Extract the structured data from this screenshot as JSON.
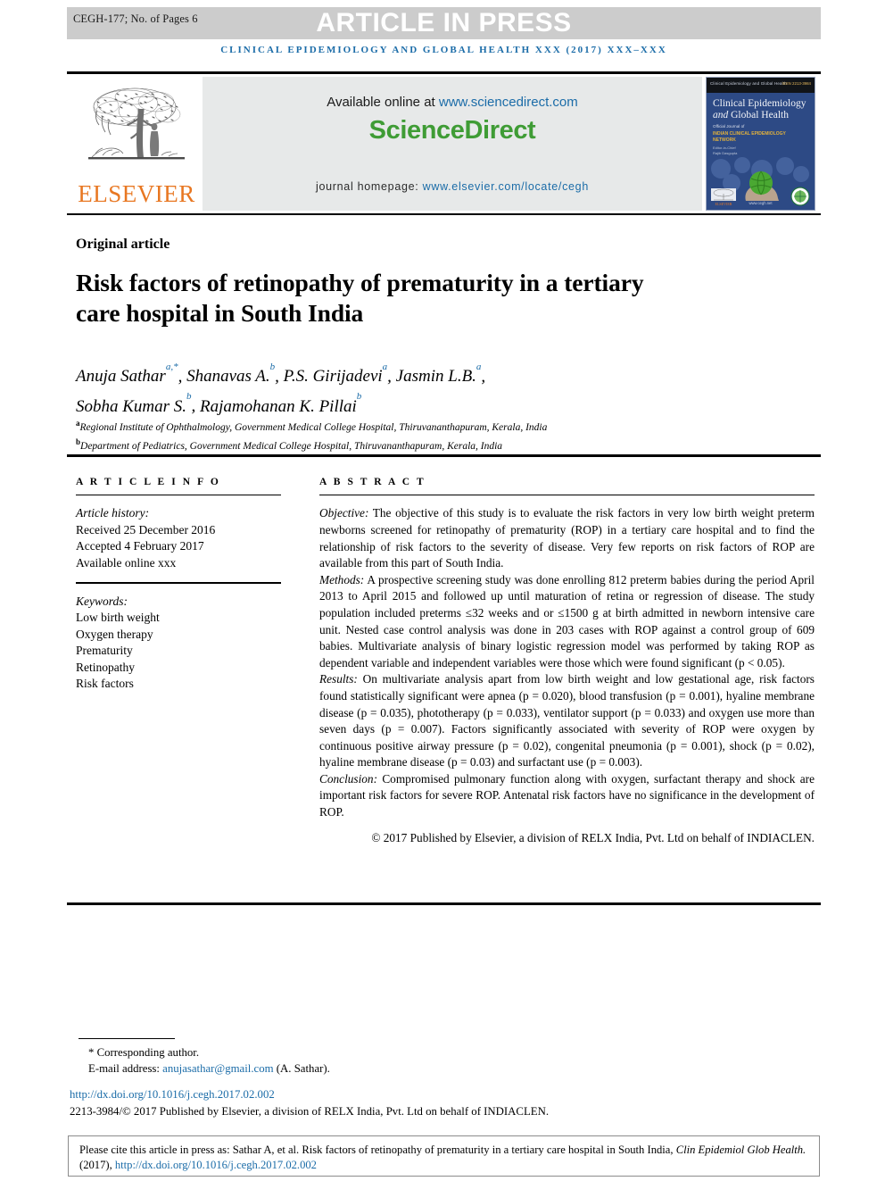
{
  "header": {
    "runhead": "CEGH-177; No. of Pages 6",
    "press_banner": "ARTICLE IN PRESS",
    "journal_running_title": "CLINICAL EPIDEMIOLOGY AND GLOBAL HEALTH XXX (2017) XXX–XXX"
  },
  "masthead": {
    "publisher_name": "ELSEVIER",
    "available_prefix": "Available online at ",
    "available_url": "www.sciencedirect.com",
    "sciencedirect_logo_a": "Science",
    "sciencedirect_logo_b": "Direct",
    "homepage_prefix": "journal homepage: ",
    "homepage_url": "www.elsevier.com/locate/cegh",
    "colors": {
      "elsevier_orange": "#E87722",
      "sciencedirect_green": "#3F9C35",
      "link_blue": "#1B6CA8",
      "banner_grey": "#CCCCCC",
      "sd_box_grey": "#E7E9E9",
      "cover_blue": "#2D4A85"
    }
  },
  "cover": {
    "top_left_text": "Clinical Epidemiology and Global Health",
    "top_right_text": "ISSN 2213-3984",
    "title_line1": "Clinical Epidemiology",
    "title_line2_italic": "and",
    "title_line2_rest": "Global Health",
    "subtitle1": "Official Journal of",
    "subtitle2": "INDIAN CLINICAL EPIDEMIOLOGY NETWORK",
    "subtitle3": "Editor-in-Chief",
    "editor": "Rajib Dasgupta",
    "bottom_center": "www.cegh.net"
  },
  "article": {
    "kicker": "Original article",
    "title": "Risk factors of retinopathy of prematurity in a tertiary care hospital in South India",
    "authors": [
      {
        "name": "Anuja Sathar",
        "sup": "a,*"
      },
      {
        "name": "Shanavas A.",
        "sup": "b"
      },
      {
        "name": "P.S. Girijadevi",
        "sup": "a"
      },
      {
        "name": "Jasmin L.B.",
        "sup": "a"
      },
      {
        "name": "Sobha Kumar S.",
        "sup": "b"
      },
      {
        "name": "Rajamohanan K. Pillai",
        "sup": "b"
      }
    ],
    "affiliations": [
      {
        "marker": "a",
        "text": "Regional Institute of Ophthalmology, Government Medical College Hospital, Thiruvananthapuram, Kerala, India"
      },
      {
        "marker": "b",
        "text": "Department of Pediatrics, Government Medical College Hospital, Thiruvananthapuram, Kerala, India"
      }
    ]
  },
  "article_info": {
    "heading": "A R T I C L E   I N F O",
    "history_label": "Article history:",
    "history": [
      "Received 25 December 2016",
      "Accepted 4 February 2017",
      "Available online xxx"
    ],
    "keywords_label": "Keywords:",
    "keywords": [
      "Low birth weight",
      "Oxygen therapy",
      "Prematurity",
      "Retinopathy",
      "Risk factors"
    ]
  },
  "abstract": {
    "heading": "A B S T R A C T",
    "objective_label": "Objective:",
    "objective_text": " The objective of this study is to evaluate the risk factors in very low birth weight preterm newborns screened for retinopathy of prematurity (ROP) in a tertiary care hospital and to find the relationship of risk factors to the severity of disease. Very few reports on risk factors of ROP are available from this part of South India.",
    "methods_label": "Methods:",
    "methods_text": " A prospective screening study was done enrolling 812 preterm babies during the period April 2013 to April 2015 and followed up until maturation of retina or regression of disease. The study population included preterms ≤32 weeks and or ≤1500 g at birth admitted in newborn intensive care unit. Nested case control analysis was done in 203 cases with ROP against a control group of 609 babies. Multivariate analysis of binary logistic regression model was performed by taking ROP as dependent variable and independent variables were those which were found significant (p < 0.05).",
    "results_label": "Results:",
    "results_text": " On multivariate analysis apart from low birth weight and low gestational age, risk factors found statistically significant were apnea (p = 0.020), blood transfusion (p = 0.001), hyaline membrane disease (p = 0.035), phototherapy (p = 0.033), ventilator support (p = 0.033) and oxygen use more than seven days (p = 0.007). Factors significantly associated with severity of ROP were oxygen by continuous positive airway pressure (p = 0.02), congenital pneumonia (p = 0.001), shock (p = 0.02), hyaline membrane disease (p = 0.03) and surfactant use (p = 0.003).",
    "conclusion_label": "Conclusion:",
    "conclusion_text": " Compromised pulmonary function along with oxygen, surfactant therapy and shock are important risk factors for severe ROP. Antenatal risk factors have no significance in the development of ROP.",
    "copyright": "© 2017 Published by Elsevier, a division of RELX India, Pvt. Ltd on behalf of INDIACLEN."
  },
  "footnotes": {
    "corresponding": "* Corresponding author.",
    "email_label": "E-mail address: ",
    "email": "anujasathar@gmail.com",
    "email_owner": " (A. Sathar).",
    "doi": "http://dx.doi.org/10.1016/j.cegh.2017.02.002",
    "issn_line": "2213-3984/© 2017 Published by Elsevier, a division of RELX India, Pvt. Ltd on behalf of INDIACLEN."
  },
  "cite_box": {
    "prefix": "Please cite this article in press as: Sathar A, et al. Risk factors of retinopathy of prematurity in a tertiary care hospital in South India, ",
    "journal_italic": "Clin Epidemiol Glob Health.",
    "middle": " (2017), ",
    "link": "http://dx.doi.org/10.1016/j.cegh.2017.02.002"
  }
}
